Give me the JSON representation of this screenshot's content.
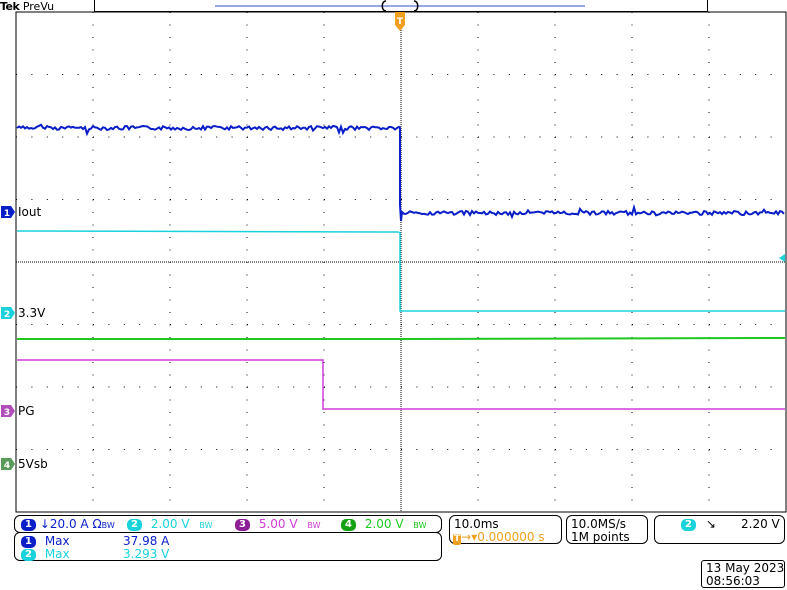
{
  "header": {
    "brand": "Tek",
    "mode": "PreVu"
  },
  "trigger": {
    "marker": "T"
  },
  "channels": [
    {
      "id": "1",
      "label": "Iout",
      "color": "#0a1ec8"
    },
    {
      "id": "2",
      "label": "3.3V",
      "color": "#19d2dc"
    },
    {
      "id": "3",
      "label": "PG",
      "color": "#d23cd7"
    },
    {
      "id": "4",
      "label": "5Vsb",
      "color": "#1ec81e"
    }
  ],
  "scales": {
    "ch1": {
      "num": "1",
      "text": "↓20.0 A",
      "suffix": "Ω",
      "bw": "BW"
    },
    "ch2": {
      "num": "2",
      "text": "2.00 V",
      "bw": "BW"
    },
    "ch3": {
      "num": "3",
      "text": "5.00 V",
      "bw": "BW"
    },
    "ch4": {
      "num": "4",
      "text": "2.00 V",
      "bw": "BW"
    }
  },
  "measurements": [
    {
      "ch": "1",
      "name": "Max",
      "value": "37.98 A"
    },
    {
      "ch": "2",
      "name": "Max",
      "value": "3.293 V"
    }
  ],
  "timebase": {
    "per_div": "10.0ms",
    "position": "0.000000 s",
    "sample_rate": "10.0MS/s",
    "record": "1M points"
  },
  "trigger_info": {
    "ch": "2",
    "slope": "↘",
    "level": "2.20 V"
  },
  "datetime": {
    "date": "13 May 2023",
    "time": "08:56:03"
  },
  "colors": {
    "ch1": "#0a1ec8",
    "ch2": "#19d2dc",
    "ch3": "#d23cd7",
    "ch4": "#1ec81e",
    "trigger": "#f0a020",
    "grid": "#000000"
  }
}
